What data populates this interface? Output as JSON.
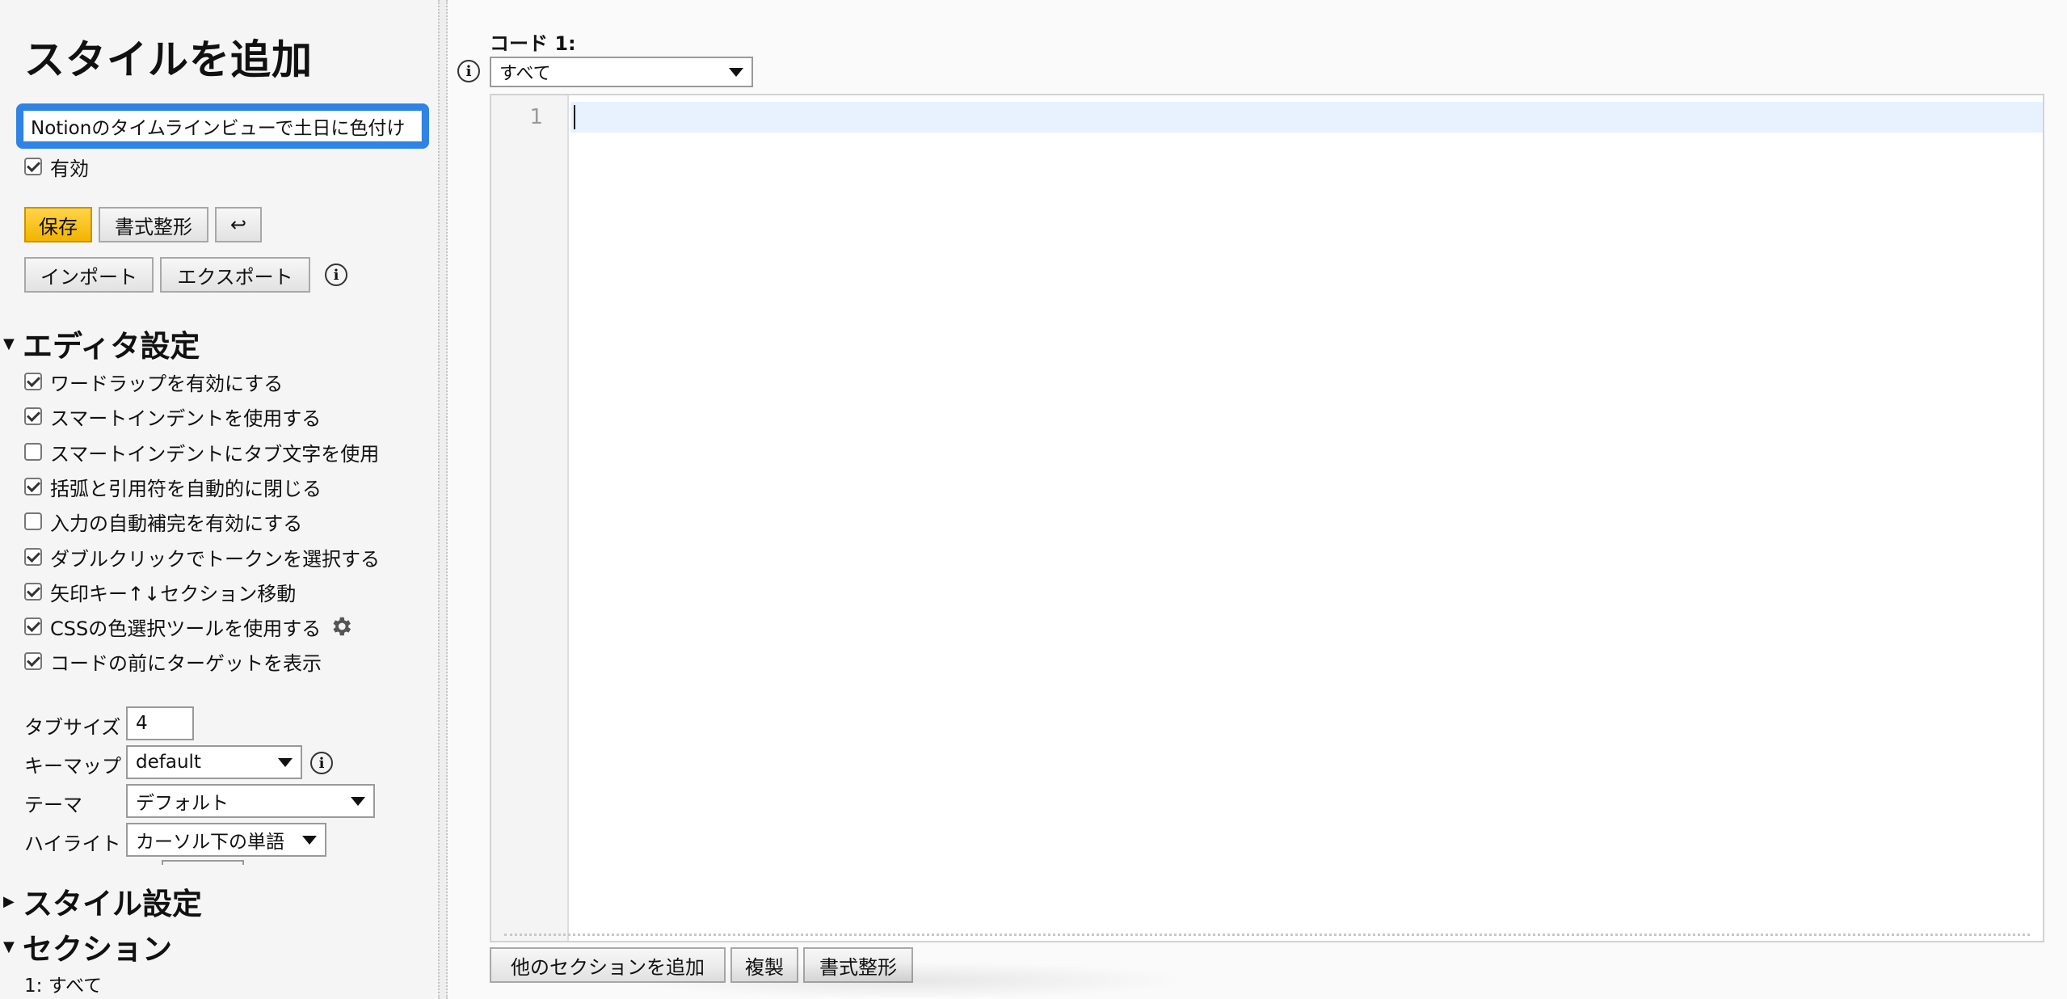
{
  "sidebar": {
    "title": "スタイルを追加",
    "style_name": "Notionのタイムラインビューで土日に色付け",
    "enabled_label": "有効",
    "enabled": true,
    "buttons": {
      "save": "保存",
      "beautify": "書式整形",
      "undo": "↩",
      "import": "インポート",
      "export": "エクスポート"
    },
    "editor_settings": {
      "heading": "エディタ設定",
      "options": [
        {
          "label": "ワードラップを有効にする",
          "checked": true
        },
        {
          "label": "スマートインデントを使用する",
          "checked": true
        },
        {
          "label": "スマートインデントにタブ文字を使用",
          "checked": false
        },
        {
          "label": "括弧と引用符を自動的に閉じる",
          "checked": true
        },
        {
          "label": "入力の自動補完を有効にする",
          "checked": false
        },
        {
          "label": "ダブルクリックでトークンを選択する",
          "checked": true
        },
        {
          "label": "矢印キー↑↓セクション移動",
          "checked": true
        },
        {
          "label": "CSSの色選択ツールを使用する",
          "checked": true
        },
        {
          "label": "コードの前にターゲットを表示",
          "checked": true
        }
      ],
      "tab_size_label": "タブサイズ",
      "tab_size_value": "4",
      "keymap_label": "キーマップ",
      "keymap_value": "default",
      "theme_label": "テーマ",
      "theme_value": "デフォルト",
      "highlight_label": "ハイライト",
      "highlight_value": "カーソル下の単語"
    },
    "style_settings_heading": "スタイル設定",
    "sections_heading": "セクション",
    "section_item": "1: すべて"
  },
  "main": {
    "code_label": "コード 1:",
    "applies_to_value": "すべて",
    "line_number": "1",
    "buttons": {
      "add_section": "他のセクションを追加",
      "clone": "複製",
      "beautify": "書式整形"
    }
  }
}
